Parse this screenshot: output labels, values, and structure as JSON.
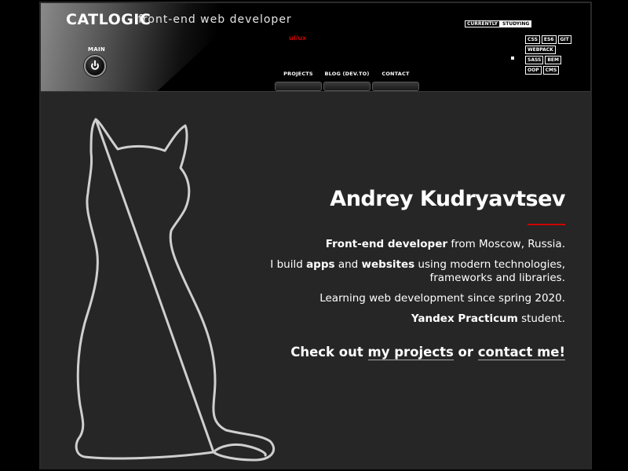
{
  "header": {
    "logo": "CATLOGIC",
    "tagline": "front-end web developer",
    "main_label": "MAIN",
    "uiux": "ui/ux",
    "studying": {
      "currently": "CURRENTLY",
      "studying": "STUDYING"
    },
    "tags": [
      "CSS",
      "ES6",
      "GIT",
      "WEBPACK",
      "SASS",
      "BEM",
      "OOP",
      "CMS"
    ]
  },
  "nav": {
    "items": [
      {
        "label": "PROJECTS"
      },
      {
        "label": "BLOG (DEV.TO)"
      },
      {
        "label": "CONTACT"
      }
    ]
  },
  "bio": {
    "name": "Andrey Kudryavtsev",
    "line1_bold": "Front-end developer",
    "line1_rest": " from Moscow, Russia.",
    "line2_a": "I build ",
    "line2_apps": "apps",
    "line2_b": " and ",
    "line2_websites": "websites",
    "line2_c": " using modern technologies,",
    "line2_d": "frameworks and libraries.",
    "line3": "Learning web development since spring 2020.",
    "line4_bold": "Yandex Practicum",
    "line4_rest": " student.",
    "cta_a": "Check out ",
    "cta_projects": "my projects",
    "cta_b": " or ",
    "cta_contact": "contact me!"
  },
  "colors": {
    "accent": "#cc0000",
    "background": "#262626",
    "header": "#000000"
  }
}
